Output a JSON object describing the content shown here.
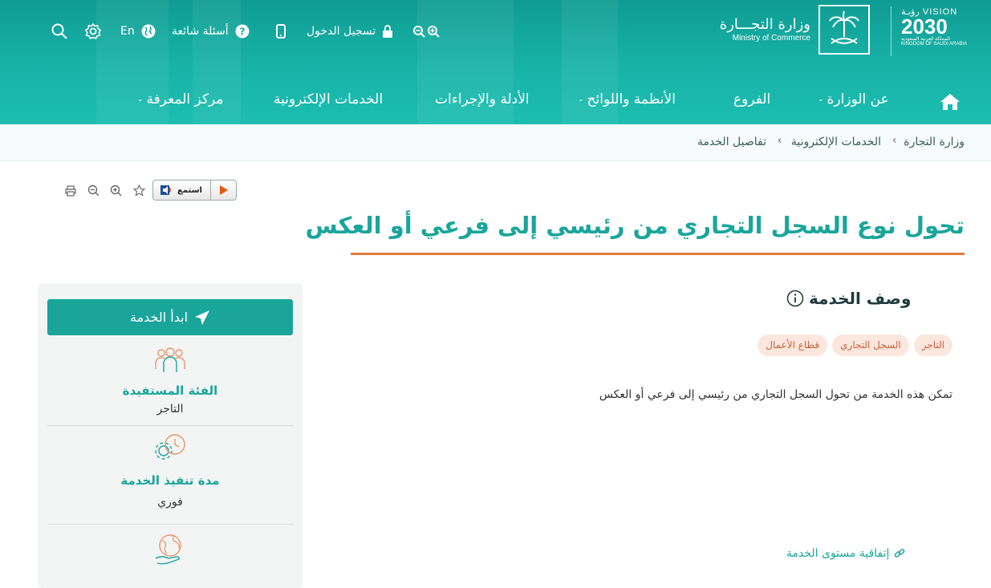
{
  "colors": {
    "primary": "#1aa59b",
    "accent_rule": "#e07a3d",
    "tag_bg": "#fbe7de",
    "tag_text": "#c8613a"
  },
  "header": {
    "vision": {
      "line1": "VISION رؤيـة",
      "line2": "2030",
      "line3": "المملكة العربية السعودية KINGDOM OF SAUDI ARABIA"
    },
    "ministry_ar": "وزارة التجـــارة",
    "ministry_en": "Ministry of Commerce",
    "topbar": {
      "login": "تسجيل الدخول",
      "faq": "أسئلة شائعة",
      "language": "En",
      "icons": [
        "zoom-in-icon",
        "zoom-out-icon",
        "lock-icon",
        "mobile-icon",
        "help-icon",
        "globe-icon",
        "gear-icon",
        "search-icon"
      ]
    },
    "nav": [
      {
        "label": "عن الوزارة",
        "has_menu": true
      },
      {
        "label": "الفروع",
        "has_menu": false
      },
      {
        "label": "الأنظمة واللوائح",
        "has_menu": true
      },
      {
        "label": "الأدلة والإجراءات",
        "has_menu": false
      },
      {
        "label": "الخدمات الإلكترونية",
        "has_menu": false
      },
      {
        "label": "مركز المعرفة",
        "has_menu": true
      }
    ]
  },
  "breadcrumb": [
    "وزارة التجارة",
    "الخدمات الإلكترونية",
    "تفاصيل الخدمة"
  ],
  "tools": {
    "listen_label": "استمع"
  },
  "page": {
    "title": "تحول نوع السجل التجاري من رئيسي إلى فرعي أو العكس",
    "section_title": "وصف الخدمة",
    "tags": [
      "التاجر",
      "السجل التجاري",
      "قطاع الأعمال"
    ],
    "description": "تمكن هذه الخدمة من تحول السجل التجاري من رئيسي إلى  فرعي أو العكس",
    "sla_link": "إتفاقية مستوى الخدمة"
  },
  "sidebar": {
    "start_button": "ابدأ الخدمة",
    "beneficiary_label": "الفئة المستفيدة",
    "beneficiary_value": "التاجر",
    "duration_label": "مدة تنفيذ الخدمة",
    "duration_value": "فوري"
  }
}
